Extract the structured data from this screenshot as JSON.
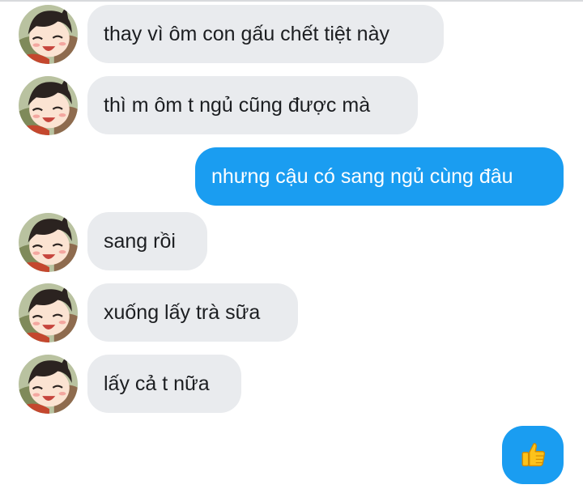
{
  "messages": [
    {
      "direction": "incoming",
      "text": "thay vì ôm con gấu chết tiệt này"
    },
    {
      "direction": "incoming",
      "text": "thì m ôm t ngủ cũng được mà"
    },
    {
      "direction": "outgoing",
      "text": "nhưng cậu có sang ngủ cùng đâu"
    },
    {
      "direction": "incoming",
      "text": "sang rồi"
    },
    {
      "direction": "incoming",
      "text": "xuống lấy trà sữa"
    },
    {
      "direction": "incoming",
      "text": "lấy cả t nữa"
    },
    {
      "direction": "outgoing",
      "type": "like",
      "icon": "thumbs-up-icon"
    }
  ],
  "colors": {
    "incoming_bubble": "#e9ebee",
    "outgoing_bubble": "#1a9df1",
    "incoming_text": "#1c1e21",
    "outgoing_text": "#ffffff"
  }
}
